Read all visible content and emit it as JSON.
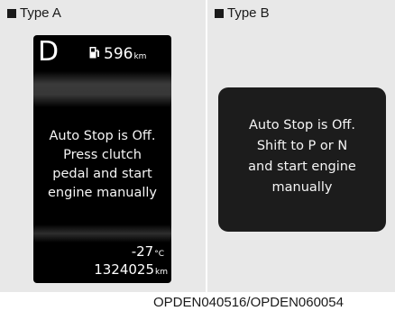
{
  "type_a": {
    "label": "Type A",
    "gear": "D",
    "fuel_range": "596",
    "fuel_unit": "km",
    "message_lines": [
      "Auto Stop is Off.",
      "Press clutch",
      "pedal and start",
      "engine manually"
    ],
    "temperature": "-27",
    "temperature_unit": "°C",
    "odometer": "1324025",
    "odometer_unit": "km"
  },
  "type_b": {
    "label": "Type B",
    "message_lines": [
      "Auto Stop is Off.",
      "Shift to P or N",
      "and start engine",
      "manually"
    ]
  },
  "caption": "OPDEN040516/OPDEN060054"
}
